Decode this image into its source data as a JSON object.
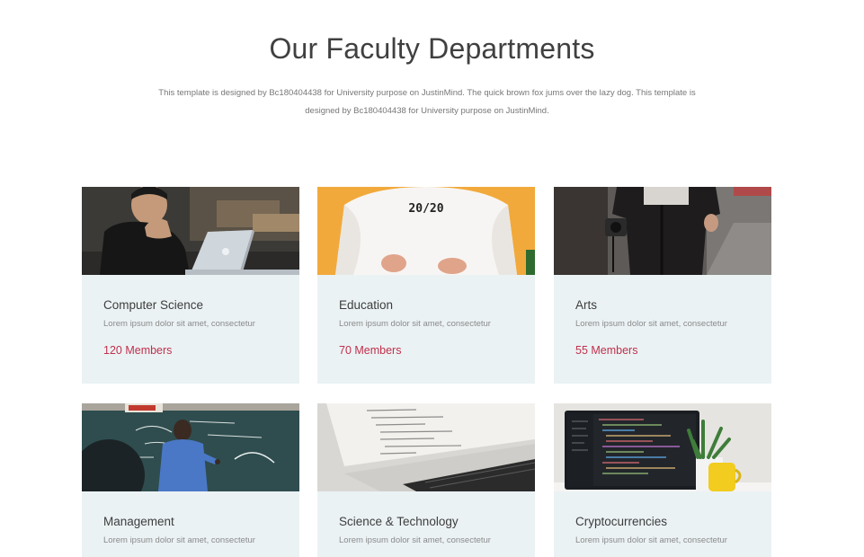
{
  "header": {
    "title": "Our Faculty Departments",
    "subtitle": "This template is designed by Bc180404438 for University purpose on JustinMind. The quick brown fox jums over the lazy dog. This template is designed by Bc180404438 for University purpose on JustinMind."
  },
  "departments": [
    {
      "name": "Computer Science",
      "description": "Lorem ipsum dolor sit amet, consectetur",
      "members": "120 Members"
    },
    {
      "name": "Education",
      "description": "Lorem ipsum dolor sit amet, consectetur",
      "members": "70 Members",
      "image_text": "20/20"
    },
    {
      "name": "Arts",
      "description": "Lorem ipsum dolor sit amet, consectetur",
      "members": "55 Members"
    },
    {
      "name": "Management",
      "description": "Lorem ipsum dolor sit amet, consectetur"
    },
    {
      "name": "Science & Technology",
      "description": "Lorem ipsum dolor sit amet, consectetur"
    },
    {
      "name": "Cryptocurrencies",
      "description": "Lorem ipsum dolor sit amet, consectetur"
    }
  ]
}
